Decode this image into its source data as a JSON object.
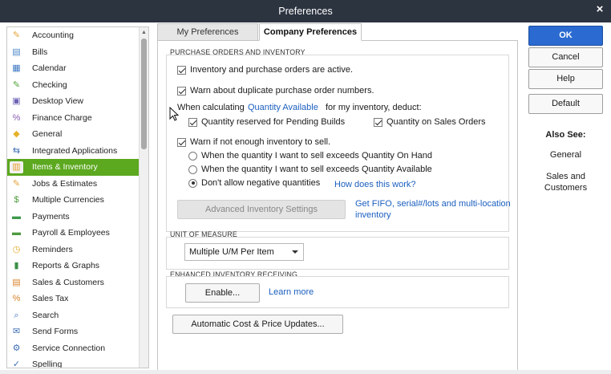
{
  "window": {
    "title": "Preferences",
    "close_glyph": "×"
  },
  "sidebar": {
    "items": [
      {
        "label": "Accounting",
        "icon": "accounting-icon",
        "glyph": "✎",
        "color": "#e8a33a"
      },
      {
        "label": "Bills",
        "icon": "bills-icon",
        "glyph": "▤",
        "color": "#4a86c9"
      },
      {
        "label": "Calendar",
        "icon": "calendar-icon",
        "glyph": "▦",
        "color": "#3d79c2"
      },
      {
        "label": "Checking",
        "icon": "checking-icon",
        "glyph": "✎",
        "color": "#53a33b"
      },
      {
        "label": "Desktop View",
        "icon": "desktop-view-icon",
        "glyph": "▣",
        "color": "#6c63b5"
      },
      {
        "label": "Finance Charge",
        "icon": "finance-charge-icon",
        "glyph": "%",
        "color": "#8a5db3"
      },
      {
        "label": "General",
        "icon": "general-icon",
        "glyph": "◆",
        "color": "#e5b22a"
      },
      {
        "label": "Integrated Applications",
        "icon": "integrated-applications-icon",
        "glyph": "⇆",
        "color": "#3f6fb5"
      },
      {
        "label": "Items & Inventory",
        "icon": "items-inventory-icon",
        "glyph": "▥",
        "color": "#e6a02b"
      },
      {
        "label": "Jobs & Estimates",
        "icon": "jobs-estimates-icon",
        "glyph": "✎",
        "color": "#e8a33a"
      },
      {
        "label": "Multiple Currencies",
        "icon": "multiple-currencies-icon",
        "glyph": "$",
        "color": "#4c9a3a"
      },
      {
        "label": "Payments",
        "icon": "payments-icon",
        "glyph": "▬",
        "color": "#3e9a4d"
      },
      {
        "label": "Payroll & Employees",
        "icon": "payroll-employees-icon",
        "glyph": "▬",
        "color": "#4d9a3f"
      },
      {
        "label": "Reminders",
        "icon": "reminders-icon",
        "glyph": "◷",
        "color": "#e3a51f"
      },
      {
        "label": "Reports & Graphs",
        "icon": "reports-graphs-icon",
        "glyph": "▮",
        "color": "#3a8f45"
      },
      {
        "label": "Sales & Customers",
        "icon": "sales-customers-icon",
        "glyph": "▤",
        "color": "#d9832a"
      },
      {
        "label": "Sales Tax",
        "icon": "sales-tax-icon",
        "glyph": "%",
        "color": "#d9832a"
      },
      {
        "label": "Search",
        "icon": "search-icon",
        "glyph": "⌕",
        "color": "#3f6fb5"
      },
      {
        "label": "Send Forms",
        "icon": "send-forms-icon",
        "glyph": "✉",
        "color": "#3f6fb5"
      },
      {
        "label": "Service Connection",
        "icon": "service-connection-icon",
        "glyph": "⚙",
        "color": "#3f6fb5"
      },
      {
        "label": "Spelling",
        "icon": "spelling-icon",
        "glyph": "✓",
        "color": "#3f6fb5"
      }
    ],
    "active_index": 8,
    "active_color": "#5ca81f"
  },
  "tabs": {
    "my_preferences": "My Preferences",
    "company_preferences": "Company Preferences"
  },
  "purchase_orders": {
    "section_title": "PURCHASE ORDERS AND INVENTORY",
    "inventory_active": {
      "label": "Inventory and purchase orders are active.",
      "checked": true
    },
    "warn_duplicate": {
      "label": "Warn about duplicate purchase order numbers.",
      "checked": true
    },
    "when_calculating": "When calculating",
    "quantity_available_link": "Quantity Available",
    "for_my_inventory": "for my inventory, deduct:",
    "reserved_pending_builds": {
      "label": "Quantity reserved for Pending Builds",
      "checked": true
    },
    "quantity_sales_orders": {
      "label": "Quantity on Sales Orders",
      "checked": true
    },
    "warn_not_enough": {
      "label": "Warn if not enough inventory to sell.",
      "checked": true
    },
    "radio_on_hand": {
      "label": "When the quantity I want to sell exceeds Quantity On Hand",
      "checked": false
    },
    "radio_available": {
      "label": "When the quantity I want to sell exceeds Quantity Available",
      "checked": false
    },
    "radio_no_negative": {
      "label": "Don't allow negative quantities",
      "checked": true
    },
    "how_does_this_work": "How does this work?",
    "advanced_button": "Advanced Inventory Settings",
    "fifo_link_line1": "Get FIFO, serial#/lots and multi-location",
    "fifo_link_line2": "inventory"
  },
  "unit_of_measure": {
    "section_title": "UNIT OF MEASURE",
    "selected": "Multiple U/M Per Item"
  },
  "receiving": {
    "section_title": "ENHANCED INVENTORY RECEIVING",
    "enable_button": "Enable...",
    "learn_more": "Learn more"
  },
  "auto_cost_button": "Automatic Cost & Price Updates...",
  "actions": {
    "ok": "OK",
    "cancel": "Cancel",
    "help": "Help",
    "default": "Default"
  },
  "also_see": {
    "title": "Also See:",
    "general": "General",
    "sales_line1": "Sales and",
    "sales_line2": "Customers"
  },
  "colors": {
    "titlebar": "#2c3440",
    "link": "#1b5fbf",
    "ok_button": "#2a6ad1"
  }
}
